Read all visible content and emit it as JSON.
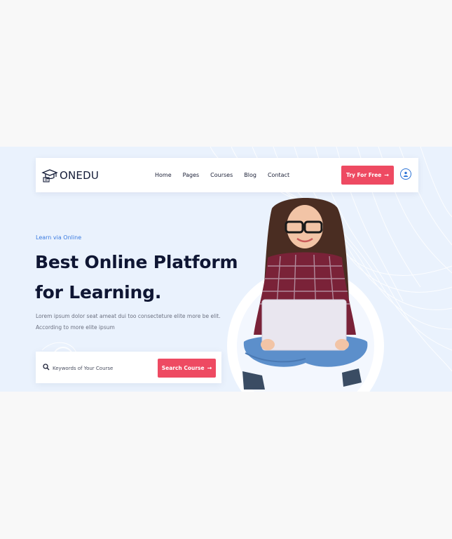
{
  "logo": {
    "text": "ONEDU",
    "icon": "graduation-cap-icon"
  },
  "nav": {
    "items": [
      {
        "label": "Home"
      },
      {
        "label": "Pages"
      },
      {
        "label": "Courses"
      },
      {
        "label": "Blog"
      },
      {
        "label": "Contact"
      }
    ],
    "cta_label": "Try For Free",
    "cta_icon": "arrow-right-icon",
    "user_icon": "user-icon"
  },
  "hero": {
    "eyebrow": "Learn via Online",
    "headline_line1": "Best Online Platform",
    "headline_line2": "for Learning.",
    "subtext": "Lorem ipsum dolor seat ameat dui too consecteture elite more be elit. According to more elite ipsum"
  },
  "search": {
    "placeholder": "Keywords of Your Course",
    "button_label": "Search Course",
    "icon": "search-icon"
  },
  "colors": {
    "accent": "#ee4a62",
    "link_blue": "#3b7be0",
    "heading": "#0f1633",
    "hero_bg": "#eaf2fd"
  }
}
